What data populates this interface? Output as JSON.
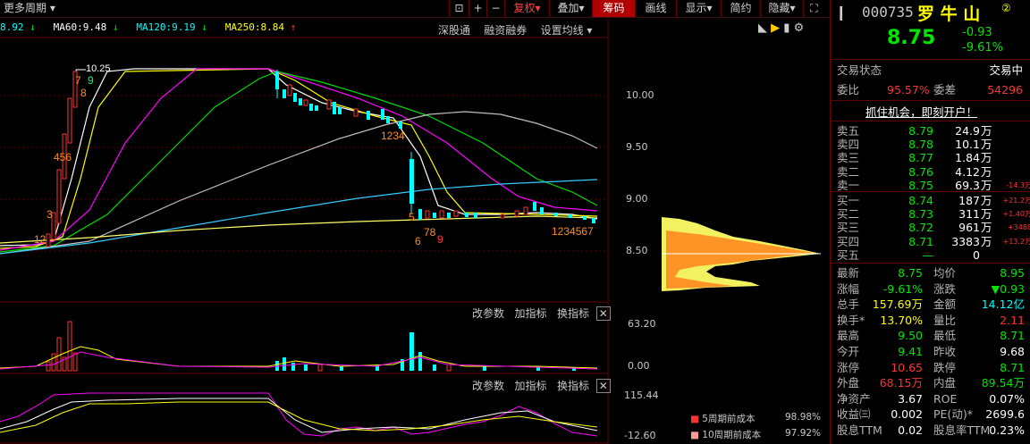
{
  "toolbar": {
    "period_label": "更多周期",
    "buttons": [
      "+",
      "−",
      "复权",
      "叠加",
      "筹码",
      "画线",
      "显示",
      "简约",
      "隐藏"
    ]
  },
  "ma_legend": [
    {
      "text": "8.92",
      "arrow": "↓",
      "color": "#00ffff"
    },
    {
      "text": "MA60:9.48",
      "arrow": "↓",
      "color": "#ffffff"
    },
    {
      "text": "MA120:9.19",
      "arrow": "↓",
      "color": "#00ffff"
    },
    {
      "text": "MA250:8.84",
      "arrow": "↑",
      "color": "#ffff00"
    }
  ],
  "chart_links": [
    "深股通",
    "融资融券",
    "设置均线"
  ],
  "price_axis": [
    "10.00",
    "9.50",
    "9.00",
    "8.50"
  ],
  "high_marker": "10.25",
  "sub1": {
    "tools": [
      "改参数",
      "加指标",
      "换指标"
    ],
    "axis_top": "63.20",
    "axis_bottom": "0.00"
  },
  "sub2": {
    "tools": [
      "改参数",
      "加指标",
      "换指标"
    ],
    "axis_top": "115.44",
    "axis_bottom": "-12.60"
  },
  "chip_legend": [
    {
      "label": "5周期前成本",
      "value": "98.98%"
    },
    {
      "label": "10周期前成本",
      "value": "97.92%"
    }
  ],
  "stock": {
    "code": "000735",
    "name": "罗 牛 山",
    "badge": "②",
    "price": "8.75",
    "change": "-0.93",
    "change_pct": "-9.61%"
  },
  "status": {
    "label": "交易状态",
    "value": "交易中"
  },
  "weibi": {
    "label1": "委比",
    "value1": "95.57%",
    "label2": "委差",
    "value2": "54296"
  },
  "promo": "抓住机会，即刻开户！",
  "asks": [
    {
      "label": "卖五",
      "price": "8.79",
      "vol": "24.9",
      "unit": "万",
      "delta": ""
    },
    {
      "label": "卖四",
      "price": "8.78",
      "vol": "10.1",
      "unit": "万",
      "delta": ""
    },
    {
      "label": "卖三",
      "price": "8.77",
      "vol": "1.84",
      "unit": "万",
      "delta": ""
    },
    {
      "label": "卖二",
      "price": "8.76",
      "vol": "4.12",
      "unit": "万",
      "delta": ""
    },
    {
      "label": "卖一",
      "price": "8.75",
      "vol": "69.3",
      "unit": "万",
      "delta": "-14.3万"
    }
  ],
  "bids": [
    {
      "label": "买一",
      "price": "8.74",
      "vol": "187",
      "unit": "万",
      "delta": "+21.2万"
    },
    {
      "label": "买二",
      "price": "8.73",
      "vol": "311",
      "unit": "万",
      "delta": "+1.40万"
    },
    {
      "label": "买三",
      "price": "8.72",
      "vol": "961",
      "unit": "万",
      "delta": "+3488"
    },
    {
      "label": "买四",
      "price": "8.71",
      "vol": "3383",
      "unit": "万",
      "delta": "+13.2万"
    },
    {
      "label": "买五",
      "price": "—",
      "vol": "0",
      "unit": "",
      "delta": ""
    }
  ],
  "stats": [
    {
      "l1": "最新",
      "v1": "8.75",
      "c1": "#00e600",
      "l2": "均价",
      "v2": "8.95",
      "c2": "#00e600"
    },
    {
      "l1": "涨幅",
      "v1": "-9.61%",
      "c1": "#00e600",
      "l2": "涨跌",
      "v2": "▼0.93",
      "c2": "#00e600"
    },
    {
      "l1": "总手",
      "v1": "157.69万",
      "c1": "#ffff00",
      "l2": "金额",
      "v2": "14.12亿",
      "c2": "#00ffff"
    },
    {
      "l1": "换手*",
      "v1": "13.70%",
      "c1": "#ffff00",
      "l2": "量比",
      "v2": "2.11",
      "c2": "#ff3232"
    },
    {
      "l1": "最高",
      "v1": "9.50",
      "c1": "#00e600",
      "l2": "最低",
      "v2": "8.71",
      "c2": "#00e600"
    },
    {
      "l1": "今开",
      "v1": "9.41",
      "c1": "#00e600",
      "l2": "昨收",
      "v2": "9.68",
      "c2": "#ffffff"
    },
    {
      "l1": "涨停",
      "v1": "10.65",
      "c1": "#ff3232",
      "l2": "跌停",
      "v2": "8.71",
      "c2": "#00e600"
    },
    {
      "l1": "外盘",
      "v1": "68.15万",
      "c1": "#ff3232",
      "l2": "内盘",
      "v2": "89.54万",
      "c2": "#00e600"
    },
    {
      "l1": "净资产",
      "v1": "3.67",
      "c1": "#ffffff",
      "l2": "ROE",
      "v2": "0.07%",
      "c2": "#ffffff"
    },
    {
      "l1": "收益㈢",
      "v1": "0.002",
      "c1": "#ffffff",
      "l2": "PE(动)*",
      "v2": "2699.6",
      "c2": "#ffffff"
    },
    {
      "l1": "股息TTM",
      "v1": "0.02",
      "c1": "#ffffff",
      "l2": "股息率TTM",
      "v2": "0.23%",
      "c2": "#ffffff"
    }
  ]
}
